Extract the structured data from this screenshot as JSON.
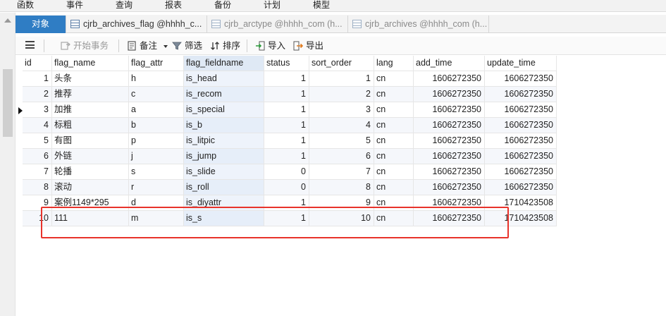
{
  "menu": [
    "函数",
    "事件",
    "查询",
    "报表",
    "备份",
    "计划",
    "模型"
  ],
  "tabs": [
    {
      "label": "对象",
      "active": false
    },
    {
      "label": "cjrb_archives_flag @hhhh_c...",
      "active": true
    },
    {
      "label": "cjrb_arctype @hhhh_com (h...",
      "active": false
    },
    {
      "label": "cjrb_archives @hhhh_com (h...",
      "active": false
    }
  ],
  "toolbar": {
    "begin_transaction": "开始事务",
    "memo": "备注",
    "filter": "筛选",
    "sort": "排序",
    "import": "导入",
    "export": "导出"
  },
  "table": {
    "columns": [
      "id",
      "flag_name",
      "flag_attr",
      "flag_fieldname",
      "status",
      "sort_order",
      "lang",
      "add_time",
      "update_time"
    ],
    "selected_column": "flag_fieldname",
    "current_row_index": 2,
    "rows": [
      [
        "1",
        "头条",
        "h",
        "is_head",
        "1",
        "1",
        "cn",
        "1606272350",
        "1606272350"
      ],
      [
        "2",
        "推荐",
        "c",
        "is_recom",
        "1",
        "2",
        "cn",
        "1606272350",
        "1606272350"
      ],
      [
        "3",
        "加推",
        "a",
        "is_special",
        "1",
        "3",
        "cn",
        "1606272350",
        "1606272350"
      ],
      [
        "4",
        "标粗",
        "b",
        "is_b",
        "1",
        "4",
        "cn",
        "1606272350",
        "1606272350"
      ],
      [
        "5",
        "有图",
        "p",
        "is_litpic",
        "1",
        "5",
        "cn",
        "1606272350",
        "1606272350"
      ],
      [
        "6",
        "外链",
        "j",
        "is_jump",
        "1",
        "6",
        "cn",
        "1606272350",
        "1606272350"
      ],
      [
        "7",
        "轮播",
        "s",
        "is_slide",
        "0",
        "7",
        "cn",
        "1606272350",
        "1606272350"
      ],
      [
        "8",
        "滚动",
        "r",
        "is_roll",
        "0",
        "8",
        "cn",
        "1606272350",
        "1606272350"
      ],
      [
        "9",
        "案例1149*295",
        "d",
        "is_diyattr",
        "1",
        "9",
        "cn",
        "1606272350",
        "1710423508"
      ],
      [
        "10",
        "111",
        "m",
        "is_s",
        "1",
        "10",
        "cn",
        "1606272350",
        "1710423508"
      ]
    ]
  },
  "colors": {
    "objects_tab_bg": "#2f7dc4",
    "highlight_border": "#e8332b",
    "selected_column_bg": "#dfe9f5"
  }
}
